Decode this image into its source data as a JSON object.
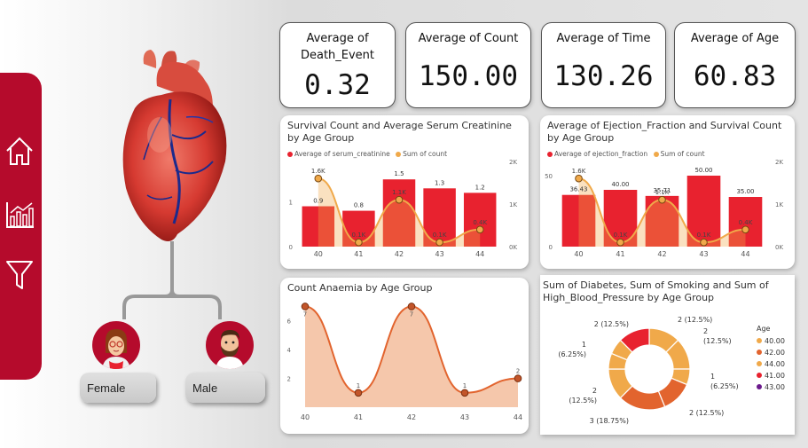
{
  "nav": {
    "items": [
      {
        "name": "home-icon"
      },
      {
        "name": "chart-icon"
      },
      {
        "name": "filter-icon"
      }
    ]
  },
  "people": {
    "female_label": "Female",
    "male_label": "Male"
  },
  "kpis": [
    {
      "title": "Average of Death_Event",
      "value": "0.32"
    },
    {
      "title": "Average of Count",
      "value": "150.00"
    },
    {
      "title": "Average of Time",
      "value": "130.26"
    },
    {
      "title": "Average of Age",
      "value": "60.83"
    }
  ],
  "colors": {
    "brand": "#b50b2c",
    "bar": "#e8222f",
    "orange": "#f0a94a",
    "area": "#f2b48f",
    "line": "#e2642e"
  },
  "chart_data": [
    {
      "type": "bar",
      "title": "Survival Count and Average Serum Creatinine by Age Group",
      "categories": [
        "40",
        "41",
        "42",
        "43",
        "44"
      ],
      "series": [
        {
          "name": "Average of serum_creatinine",
          "values": [
            0.9,
            0.8,
            1.5,
            1.3,
            1.2
          ],
          "labels": [
            "0.9",
            "0.8",
            "1.5",
            "1.3",
            "1.2"
          ]
        },
        {
          "name": "Sum of count",
          "values": [
            1.6,
            0.1,
            1.1,
            0.1,
            0.4
          ],
          "labels": [
            "1.6K",
            "0.1K",
            "1.1K",
            "0.1K",
            "0.4K"
          ]
        }
      ],
      "y_ticks": [
        "0",
        "1"
      ],
      "y2_ticks": [
        "0K",
        "1K",
        "2K"
      ]
    },
    {
      "type": "bar",
      "title": "Average of Ejection_Fraction and Survival Count by Age Group",
      "categories": [
        "40",
        "41",
        "42",
        "43",
        "44"
      ],
      "series": [
        {
          "name": "Average of ejection_fraction",
          "values": [
            36.43,
            40.0,
            35.71,
            50.0,
            35.0
          ],
          "labels": [
            "36.43",
            "40.00",
            "35.71",
            "50.00",
            "35.00"
          ]
        },
        {
          "name": "Sum of count",
          "values": [
            1.6,
            0.1,
            1.1,
            0.1,
            0.4
          ],
          "labels": [
            "1.6K",
            "0.1K",
            "1.1K",
            "0.1K",
            "0.4K"
          ]
        }
      ],
      "y_ticks": [
        "0",
        "50"
      ],
      "y2_ticks": [
        "0K",
        "1K",
        "2K"
      ]
    },
    {
      "type": "area",
      "title": "Count Anaemia by Age Group",
      "categories": [
        "40",
        "41",
        "42",
        "43",
        "44"
      ],
      "values": [
        7,
        1,
        7,
        1,
        2
      ],
      "y_ticks": [
        "2",
        "4",
        "6"
      ]
    },
    {
      "type": "pie",
      "title": "Sum of Diabetes, Sum of Smoking and Sum of High_Blood_Pressure by Age Group",
      "legend_title": "Age",
      "legend": [
        {
          "label": "40.00",
          "color": "#f0a94a"
        },
        {
          "label": "42.00",
          "color": "#e2642e"
        },
        {
          "label": "44.00",
          "color": "#f0a94a"
        },
        {
          "label": "41.00",
          "color": "#e8222f"
        },
        {
          "label": "43.00",
          "color": "#6b1a8c"
        }
      ],
      "slices": [
        {
          "value": 2,
          "color": "#f0a94a",
          "label1": "2 (12.5%)",
          "label2": ""
        },
        {
          "value": 2,
          "color": "#f0a94a",
          "label1": "2",
          "label2": "(12.5%)"
        },
        {
          "value": 1,
          "color": "#f0a94a",
          "label1": "1",
          "label2": "(6.25%)"
        },
        {
          "value": 2,
          "color": "#e2642e",
          "label1": "2 (12.5%)",
          "label2": ""
        },
        {
          "value": 3,
          "color": "#e2642e",
          "label1": "3 (18.75%)",
          "label2": ""
        },
        {
          "value": 2,
          "color": "#f0a94a",
          "label1": "2",
          "label2": "(12.5%)"
        },
        {
          "value": 1,
          "color": "#f0a94a",
          "label1": "1",
          "label2": "(6.25%)"
        },
        {
          "value": 1,
          "color": "#f0a94a",
          "label1": "2 (12.5%)",
          "label2": ""
        },
        {
          "value": 2,
          "color": "#e8222f",
          "label1": "",
          "label2": ""
        }
      ]
    }
  ]
}
